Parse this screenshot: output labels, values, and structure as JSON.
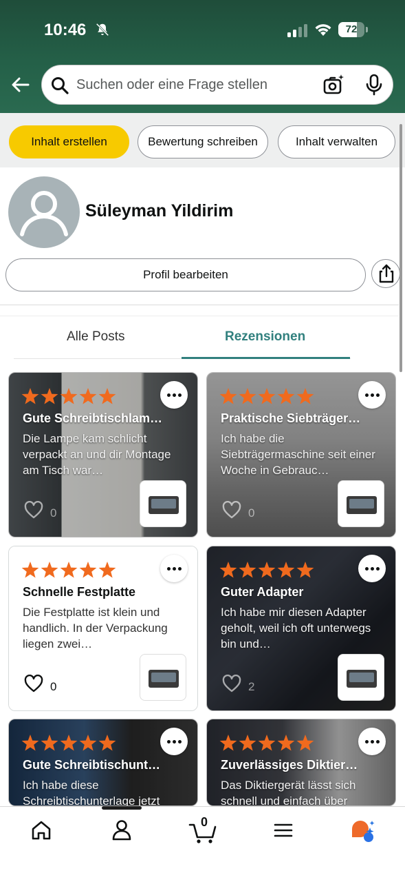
{
  "status_bar": {
    "time": "10:46",
    "battery": "72",
    "battery_level": 0.72
  },
  "search": {
    "placeholder": "Suchen oder eine Frage stellen"
  },
  "actions": {
    "create": "Inhalt erstellen",
    "review": "Bewertung schreiben",
    "manage": "Inhalt verwalten"
  },
  "profile": {
    "name": "Süleyman Yildirim",
    "edit_label": "Profil bearbeiten"
  },
  "tabs": [
    {
      "label": "Alle Posts",
      "active": false
    },
    {
      "label": "Rezensionen",
      "active": true
    }
  ],
  "reviews": [
    {
      "title": "Gute Schreibtischlam…",
      "body": "Die Lampe kam schlicht verpackt an und dir Montage am Tisch war…",
      "likes": "0",
      "stars": 5,
      "style": "dark"
    },
    {
      "title": "Praktische Siebträger…",
      "body": "Ich habe die Siebträgermaschine seit einer Woche in Gebrauc…",
      "likes": "0",
      "stars": 5,
      "style": "dark"
    },
    {
      "title": "Schnelle Festplatte",
      "body": "Die Festplatte ist klein und handlich. In der Verpackung liegen zwei…",
      "likes": "0",
      "stars": 5,
      "style": "light"
    },
    {
      "title": "Guter Adapter",
      "body": "Ich habe mir diesen Adapter geholt, weil ich oft unterwegs bin und…",
      "likes": "2",
      "stars": 5,
      "style": "dark"
    },
    {
      "title": "Gute Schreibtischunt…",
      "body": "Ich habe diese Schreibtischunterlage jetzt",
      "likes": "",
      "stars": 5,
      "style": "dark"
    },
    {
      "title": "Zuverlässiges Diktier…",
      "body": "Das Diktiergerät lässt sich schnell und einfach über",
      "likes": "",
      "stars": 5,
      "style": "dark"
    }
  ],
  "nav": [
    "home-icon",
    "account-icon",
    "cart-icon",
    "menu-icon",
    "rufus-icon"
  ],
  "cart": {
    "count": "0"
  },
  "colors": {
    "accent": "#31807e",
    "star": "#f06a1e",
    "chip_primary": "#f7ca00"
  }
}
